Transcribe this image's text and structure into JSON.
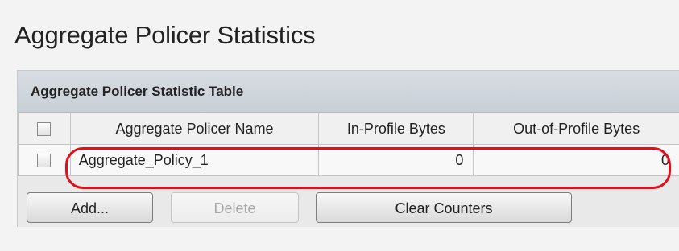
{
  "page": {
    "title": "Aggregate Policer Statistics"
  },
  "table": {
    "caption": "Aggregate Policer Statistic Table",
    "columns": [
      "",
      "Aggregate Policer Name",
      "In-Profile Bytes",
      "Out-of-Profile Bytes"
    ],
    "rows": [
      {
        "name": "Aggregate_Policy_1",
        "in_profile_bytes": "0",
        "out_of_profile_bytes": "0",
        "checked": false
      }
    ]
  },
  "buttons": {
    "add": "Add...",
    "delete": "Delete",
    "clear_counters": "Clear Counters"
  },
  "colors": {
    "highlight": "#e0101a",
    "header": "#c8cfd6"
  }
}
